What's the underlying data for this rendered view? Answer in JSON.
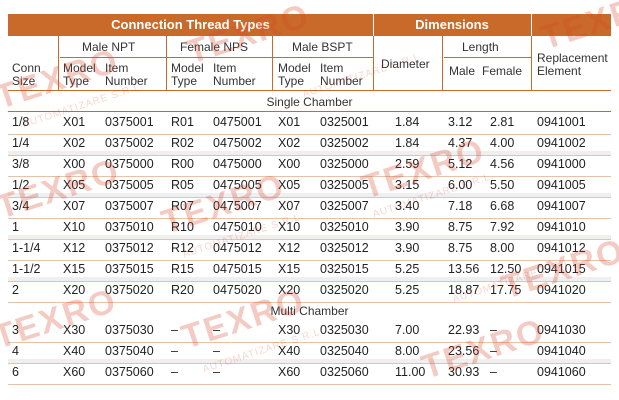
{
  "header": {
    "connection_thread_types": "Connection Thread Types",
    "dimensions": "Dimensions"
  },
  "groups": {
    "male_npt": "Male NPT",
    "female_nps": "Female NPS",
    "male_bspt": "Male BSPT",
    "length": "Length",
    "replacement_element": "Replacement Element",
    "diameter": "Diameter",
    "conn_size": "Conn Size"
  },
  "subheaders": {
    "model_type": "Model Type",
    "item_number": "Item Number",
    "male": "Male",
    "female": "Female"
  },
  "sections": {
    "single": "Single Chamber",
    "multi": "Multi Chamber"
  },
  "single_rows": [
    {
      "size": "1/8",
      "npt_model": "X01",
      "npt_item": "0375001",
      "nps_model": "R01",
      "nps_item": "0475001",
      "bspt_model": "X01",
      "bspt_item": "0325001",
      "diameter": "1.84",
      "male": "3.12",
      "female": "2.81",
      "repl": "0941001"
    },
    {
      "size": "1/4",
      "npt_model": "X02",
      "npt_item": "0375002",
      "nps_model": "R02",
      "nps_item": "0475002",
      "bspt_model": "X02",
      "bspt_item": "0325002",
      "diameter": "1.84",
      "male": "4.37",
      "female": "4.00",
      "repl": "0941002"
    },
    {
      "size": "3/8",
      "npt_model": "X00",
      "npt_item": "0375000",
      "nps_model": "R00",
      "nps_item": "0475000",
      "bspt_model": "X00",
      "bspt_item": "0325000",
      "diameter": "2.59",
      "male": "5.12",
      "female": "4.56",
      "repl": "0941000"
    },
    {
      "size": "1/2",
      "npt_model": "X05",
      "npt_item": "0375005",
      "nps_model": "R05",
      "nps_item": "0475005",
      "bspt_model": "X05",
      "bspt_item": "0325005",
      "diameter": "3.15",
      "male": "6.00",
      "female": "5.50",
      "repl": "0941005"
    },
    {
      "size": "3/4",
      "npt_model": "X07",
      "npt_item": "0375007",
      "nps_model": "R07",
      "nps_item": "0475007",
      "bspt_model": "X07",
      "bspt_item": "0325007",
      "diameter": "3.40",
      "male": "7.18",
      "female": "6.68",
      "repl": "0941007"
    },
    {
      "size": "1",
      "npt_model": "X10",
      "npt_item": "0375010",
      "nps_model": "R10",
      "nps_item": "0475010",
      "bspt_model": "X10",
      "bspt_item": "0325010",
      "diameter": "3.90",
      "male": "8.75",
      "female": "7.92",
      "repl": "0941010"
    },
    {
      "size": "1-1/4",
      "npt_model": "X12",
      "npt_item": "0375012",
      "nps_model": "R12",
      "nps_item": "0475012",
      "bspt_model": "X12",
      "bspt_item": "0325012",
      "diameter": "3.90",
      "male": "8.75",
      "female": "8.00",
      "repl": "0941012"
    },
    {
      "size": "1-1/2",
      "npt_model": "X15",
      "npt_item": "0375015",
      "nps_model": "R15",
      "nps_item": "0475015",
      "bspt_model": "X15",
      "bspt_item": "0325015",
      "diameter": "5.25",
      "male": "13.56",
      "female": "12.50",
      "repl": "0941015"
    },
    {
      "size": "2",
      "npt_model": "X20",
      "npt_item": "0375020",
      "nps_model": "R20",
      "nps_item": "0475020",
      "bspt_model": "X20",
      "bspt_item": "0325020",
      "diameter": "5.25",
      "male": "18.87",
      "female": "17.75",
      "repl": "0941020"
    }
  ],
  "multi_rows": [
    {
      "size": "3",
      "npt_model": "X30",
      "npt_item": "0375030",
      "nps_model": "–",
      "nps_item": "–",
      "bspt_model": "X30",
      "bspt_item": "0325030",
      "diameter": "7.00",
      "male": "22.93",
      "female": "–",
      "repl": "0941030"
    },
    {
      "size": "4",
      "npt_model": "X40",
      "npt_item": "0375040",
      "nps_model": "–",
      "nps_item": "–",
      "bspt_model": "X40",
      "bspt_item": "0325040",
      "diameter": "8.00",
      "male": "23.56",
      "female": "–",
      "repl": "0941040"
    },
    {
      "size": "6",
      "npt_model": "X60",
      "npt_item": "0375060",
      "nps_model": "–",
      "nps_item": "–",
      "bspt_model": "X60",
      "bspt_item": "0325060",
      "diameter": "11.00",
      "male": "30.93",
      "female": "–",
      "repl": "0941060"
    }
  ],
  "watermark": {
    "brand": "TEXRO",
    "sub": "AUTOMATIZARE S.R.L."
  },
  "colors": {
    "accent": "#c96a2a",
    "row_band": "#efefef"
  }
}
